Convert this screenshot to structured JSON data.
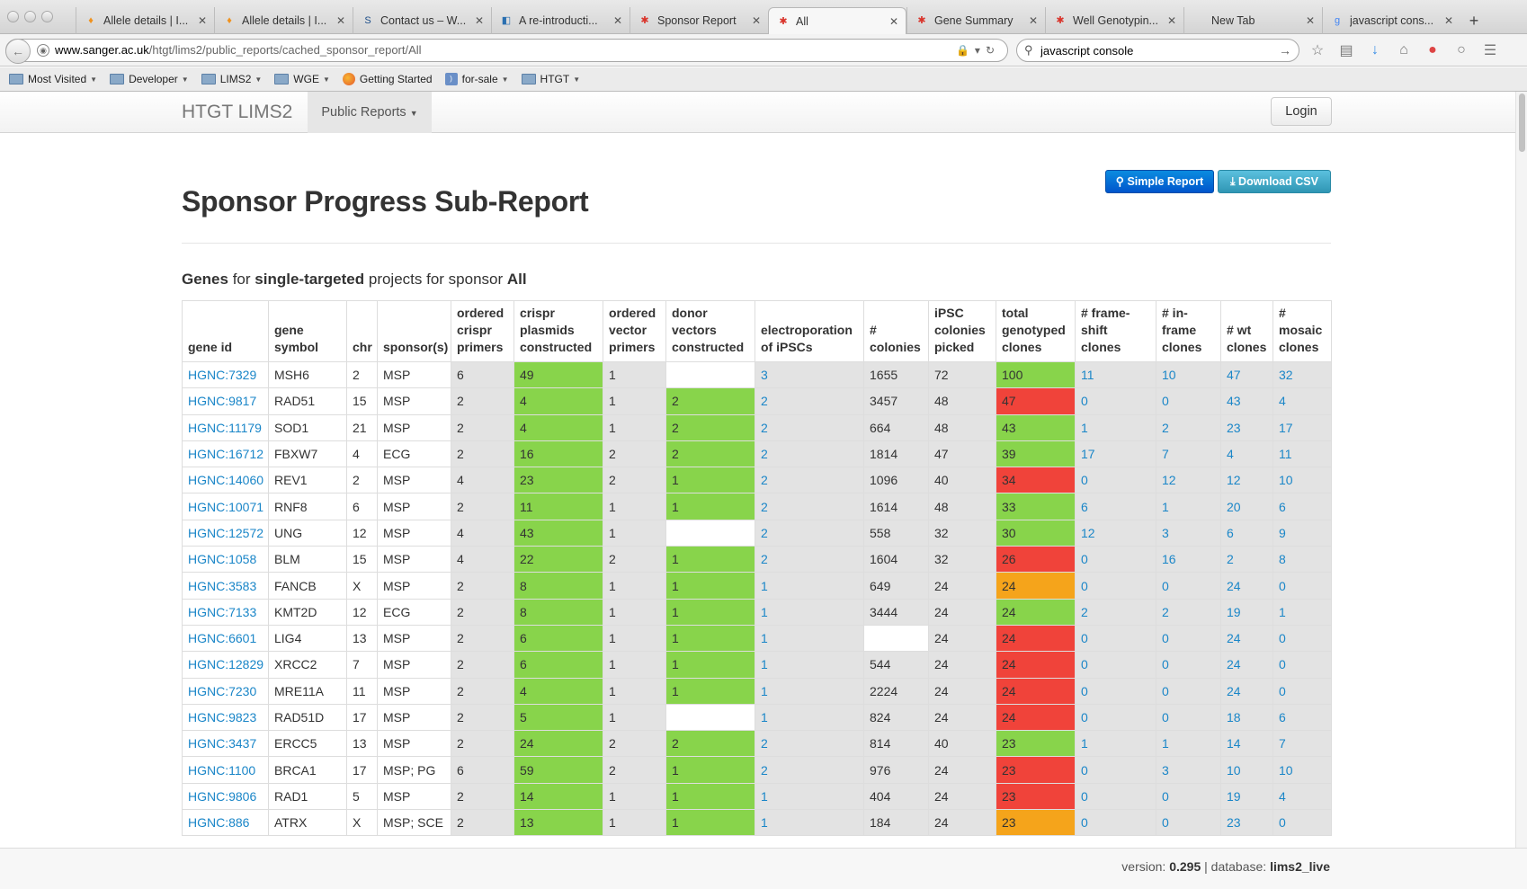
{
  "browser": {
    "tabs": [
      {
        "title": "Allele details | I...",
        "icon": "♦",
        "color": "#f0921e",
        "active": false
      },
      {
        "title": "Allele details | I...",
        "icon": "♦",
        "color": "#f0921e",
        "active": false
      },
      {
        "title": "Contact us – W...",
        "icon": "S",
        "color": "#1d4e89",
        "active": false
      },
      {
        "title": "A re-introducti...",
        "icon": "◧",
        "color": "#2a6fb0",
        "active": false
      },
      {
        "title": "Sponsor Report",
        "icon": "✱",
        "color": "#d9342b",
        "active": false
      },
      {
        "title": "All",
        "icon": "✱",
        "color": "#d9342b",
        "active": true
      },
      {
        "title": "Gene Summary",
        "icon": "✱",
        "color": "#d9342b",
        "active": false
      },
      {
        "title": "Well Genotypin...",
        "icon": "✱",
        "color": "#d9342b",
        "active": false
      },
      {
        "title": "New Tab",
        "icon": "",
        "color": "#999999",
        "active": false
      },
      {
        "title": "javascript cons...",
        "icon": "g",
        "color": "#4285f4",
        "active": false
      }
    ],
    "url_host": "www.sanger.ac.uk",
    "url_path": "/htgt/lims2/public_reports/cached_sponsor_report/All",
    "search_value": "javascript console",
    "bookmarks": [
      {
        "label": "Most Visited",
        "icon": "folder-icon",
        "menu": true
      },
      {
        "label": "Developer",
        "icon": "folder-icon",
        "menu": true
      },
      {
        "label": "LIMS2",
        "icon": "folder-icon",
        "menu": true
      },
      {
        "label": "WGE",
        "icon": "folder-icon",
        "menu": true
      },
      {
        "label": "Getting Started",
        "icon": "firefox-icon",
        "menu": false
      },
      {
        "label": "for-sale",
        "icon": "rss-icon",
        "menu": true
      },
      {
        "label": "HTGT",
        "icon": "folder-icon",
        "menu": true
      }
    ]
  },
  "app": {
    "brand": "HTGT LIMS2",
    "nav_public_reports": "Public Reports",
    "login": "Login"
  },
  "buttons": {
    "simple_report": "Simple Report",
    "download_csv": "Download CSV"
  },
  "page": {
    "title": "Sponsor Progress Sub-Report",
    "subtitle_genes": "Genes",
    "subtitle_for": " for ",
    "subtitle_type": "single-targeted",
    "subtitle_mid": " projects for sponsor ",
    "subtitle_sponsor": "All"
  },
  "table": {
    "headers": [
      "gene id",
      "gene symbol",
      "chr",
      "sponsor(s)",
      "ordered crispr primers",
      "crispr plasmids constructed",
      "ordered vector primers",
      "donor vectors constructed",
      "electroporation of iPSCs",
      "# colonies",
      "iPSC colonies picked",
      "total genotyped clones",
      "# frame-shift clones",
      "# in-frame clones",
      "# wt clones",
      "# mosaic clones"
    ],
    "rows": [
      {
        "gene_id": "HGNC:7329",
        "symbol": "MSH6",
        "chr": "2",
        "sponsor": "MSP",
        "ocp": "6",
        "cpc": "49",
        "ovp": "1",
        "dvc": "",
        "eoi": "3",
        "col": "1655",
        "pick": "72",
        "total": "100",
        "total_status": "green",
        "fs": "11",
        "inf": "10",
        "wt": "47",
        "mos": "32"
      },
      {
        "gene_id": "HGNC:9817",
        "symbol": "RAD51",
        "chr": "15",
        "sponsor": "MSP",
        "ocp": "2",
        "cpc": "4",
        "ovp": "1",
        "dvc": "2",
        "eoi": "2",
        "col": "3457",
        "pick": "48",
        "total": "47",
        "total_status": "red",
        "fs": "0",
        "inf": "0",
        "wt": "43",
        "mos": "4"
      },
      {
        "gene_id": "HGNC:11179",
        "symbol": "SOD1",
        "chr": "21",
        "sponsor": "MSP",
        "ocp": "2",
        "cpc": "4",
        "ovp": "1",
        "dvc": "2",
        "eoi": "2",
        "col": "664",
        "pick": "48",
        "total": "43",
        "total_status": "green",
        "fs": "1",
        "inf": "2",
        "wt": "23",
        "mos": "17"
      },
      {
        "gene_id": "HGNC:16712",
        "symbol": "FBXW7",
        "chr": "4",
        "sponsor": "ECG",
        "ocp": "2",
        "cpc": "16",
        "ovp": "2",
        "dvc": "2",
        "eoi": "2",
        "col": "1814",
        "pick": "47",
        "total": "39",
        "total_status": "green",
        "fs": "17",
        "inf": "7",
        "wt": "4",
        "mos": "11"
      },
      {
        "gene_id": "HGNC:14060",
        "symbol": "REV1",
        "chr": "2",
        "sponsor": "MSP",
        "ocp": "4",
        "cpc": "23",
        "ovp": "2",
        "dvc": "1",
        "eoi": "2",
        "col": "1096",
        "pick": "40",
        "total": "34",
        "total_status": "red",
        "fs": "0",
        "inf": "12",
        "wt": "12",
        "mos": "10"
      },
      {
        "gene_id": "HGNC:10071",
        "symbol": "RNF8",
        "chr": "6",
        "sponsor": "MSP",
        "ocp": "2",
        "cpc": "11",
        "ovp": "1",
        "dvc": "1",
        "eoi": "2",
        "col": "1614",
        "pick": "48",
        "total": "33",
        "total_status": "green",
        "fs": "6",
        "inf": "1",
        "wt": "20",
        "mos": "6"
      },
      {
        "gene_id": "HGNC:12572",
        "symbol": "UNG",
        "chr": "12",
        "sponsor": "MSP",
        "ocp": "4",
        "cpc": "43",
        "ovp": "1",
        "dvc": "",
        "eoi": "2",
        "col": "558",
        "pick": "32",
        "total": "30",
        "total_status": "green",
        "fs": "12",
        "inf": "3",
        "wt": "6",
        "mos": "9"
      },
      {
        "gene_id": "HGNC:1058",
        "symbol": "BLM",
        "chr": "15",
        "sponsor": "MSP",
        "ocp": "4",
        "cpc": "22",
        "ovp": "2",
        "dvc": "1",
        "eoi": "2",
        "col": "1604",
        "pick": "32",
        "total": "26",
        "total_status": "red",
        "fs": "0",
        "inf": "16",
        "wt": "2",
        "mos": "8"
      },
      {
        "gene_id": "HGNC:3583",
        "symbol": "FANCB",
        "chr": "X",
        "sponsor": "MSP",
        "ocp": "2",
        "cpc": "8",
        "ovp": "1",
        "dvc": "1",
        "eoi": "1",
        "col": "649",
        "pick": "24",
        "total": "24",
        "total_status": "orange",
        "fs": "0",
        "inf": "0",
        "wt": "24",
        "mos": "0"
      },
      {
        "gene_id": "HGNC:7133",
        "symbol": "KMT2D",
        "chr": "12",
        "sponsor": "ECG",
        "ocp": "2",
        "cpc": "8",
        "ovp": "1",
        "dvc": "1",
        "eoi": "1",
        "col": "3444",
        "pick": "24",
        "total": "24",
        "total_status": "green",
        "fs": "2",
        "inf": "2",
        "wt": "19",
        "mos": "1"
      },
      {
        "gene_id": "HGNC:6601",
        "symbol": "LIG4",
        "chr": "13",
        "sponsor": "MSP",
        "ocp": "2",
        "cpc": "6",
        "ovp": "1",
        "dvc": "1",
        "eoi": "1",
        "col": "",
        "pick": "24",
        "total": "24",
        "total_status": "red",
        "fs": "0",
        "inf": "0",
        "wt": "24",
        "mos": "0"
      },
      {
        "gene_id": "HGNC:12829",
        "symbol": "XRCC2",
        "chr": "7",
        "sponsor": "MSP",
        "ocp": "2",
        "cpc": "6",
        "ovp": "1",
        "dvc": "1",
        "eoi": "1",
        "col": "544",
        "pick": "24",
        "total": "24",
        "total_status": "red",
        "fs": "0",
        "inf": "0",
        "wt": "24",
        "mos": "0"
      },
      {
        "gene_id": "HGNC:7230",
        "symbol": "MRE11A",
        "chr": "11",
        "sponsor": "MSP",
        "ocp": "2",
        "cpc": "4",
        "ovp": "1",
        "dvc": "1",
        "eoi": "1",
        "col": "2224",
        "pick": "24",
        "total": "24",
        "total_status": "red",
        "fs": "0",
        "inf": "0",
        "wt": "24",
        "mos": "0"
      },
      {
        "gene_id": "HGNC:9823",
        "symbol": "RAD51D",
        "chr": "17",
        "sponsor": "MSP",
        "ocp": "2",
        "cpc": "5",
        "ovp": "1",
        "dvc": "",
        "eoi": "1",
        "col": "824",
        "pick": "24",
        "total": "24",
        "total_status": "red",
        "fs": "0",
        "inf": "0",
        "wt": "18",
        "mos": "6"
      },
      {
        "gene_id": "HGNC:3437",
        "symbol": "ERCC5",
        "chr": "13",
        "sponsor": "MSP",
        "ocp": "2",
        "cpc": "24",
        "ovp": "2",
        "dvc": "2",
        "eoi": "2",
        "col": "814",
        "pick": "40",
        "total": "23",
        "total_status": "green",
        "fs": "1",
        "inf": "1",
        "wt": "14",
        "mos": "7"
      },
      {
        "gene_id": "HGNC:1100",
        "symbol": "BRCA1",
        "chr": "17",
        "sponsor": "MSP; PG",
        "ocp": "6",
        "cpc": "59",
        "ovp": "2",
        "dvc": "1",
        "eoi": "2",
        "col": "976",
        "pick": "24",
        "total": "23",
        "total_status": "red",
        "fs": "0",
        "inf": "3",
        "wt": "10",
        "mos": "10"
      },
      {
        "gene_id": "HGNC:9806",
        "symbol": "RAD1",
        "chr": "5",
        "sponsor": "MSP",
        "ocp": "2",
        "cpc": "14",
        "ovp": "1",
        "dvc": "1",
        "eoi": "1",
        "col": "404",
        "pick": "24",
        "total": "23",
        "total_status": "red",
        "fs": "0",
        "inf": "0",
        "wt": "19",
        "mos": "4"
      },
      {
        "gene_id": "HGNC:886",
        "symbol": "ATRX",
        "chr": "X",
        "sponsor": "MSP; SCE",
        "ocp": "2",
        "cpc": "13",
        "ovp": "1",
        "dvc": "1",
        "eoi": "1",
        "col": "184",
        "pick": "24",
        "total": "23",
        "total_status": "orange",
        "fs": "0",
        "inf": "0",
        "wt": "23",
        "mos": "0"
      }
    ]
  },
  "footer": {
    "version_label": "version:",
    "version": "0.295",
    "db_label": "database:",
    "database": "lims2_live"
  }
}
